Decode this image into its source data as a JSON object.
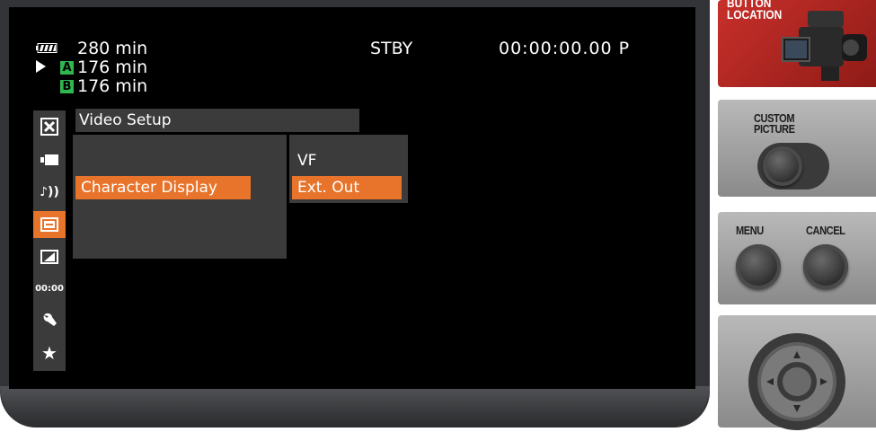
{
  "status": {
    "battery_time": "280 min",
    "slot_a_label": "A",
    "slot_a_time": "176 min",
    "slot_b_label": "B",
    "slot_b_time": "176 min",
    "mode": "STBY",
    "timecode": "00:00:00.00 P"
  },
  "menu": {
    "title": "Video Setup",
    "items": [
      "Character Display"
    ],
    "submenu": [
      "VF",
      "Ext. Out"
    ],
    "selected_item": "Character Display",
    "selected_subitem": "Ext. Out"
  },
  "side_icons": [
    {
      "name": "close-icon",
      "glyph": "✖"
    },
    {
      "name": "camera-icon",
      "glyph": ""
    },
    {
      "name": "audio-icon",
      "glyph": "♪))"
    },
    {
      "name": "video-setup-icon",
      "glyph": "",
      "selected": true
    },
    {
      "name": "lcd-setup-icon",
      "glyph": ""
    },
    {
      "name": "timecode-icon",
      "glyph": "00:00"
    },
    {
      "name": "system-setup-icon",
      "glyph": "🔧"
    },
    {
      "name": "my-menu-icon",
      "glyph": "★"
    }
  ],
  "buttons": {
    "location_label_line1": "BUTTON",
    "location_label_line2": "LOCATION",
    "custom_picture_line1": "CUSTOM",
    "custom_picture_line2": "PICTURE",
    "menu": "MENU",
    "cancel": "CANCEL"
  },
  "colors": {
    "accent": "#e8732a",
    "slot_badge": "#2fb64e",
    "panel": "#3b3b3b"
  }
}
